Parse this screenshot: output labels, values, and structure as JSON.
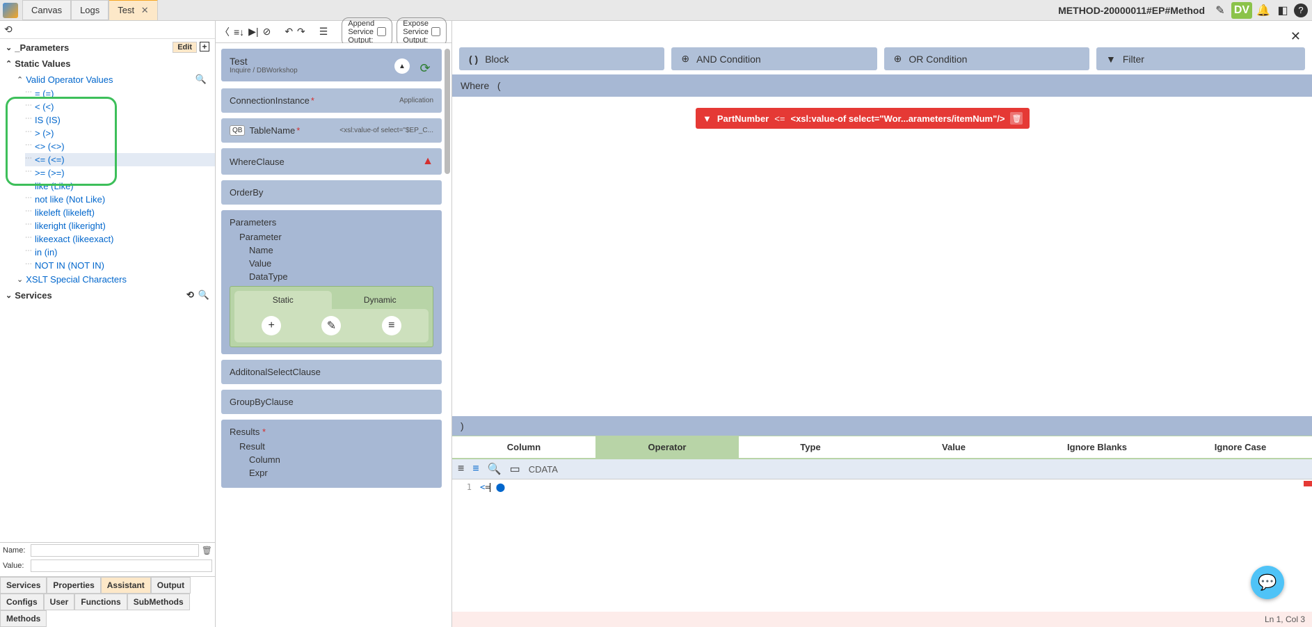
{
  "top": {
    "tabs": [
      "Canvas",
      "Logs",
      "Test"
    ],
    "active_tab": 2,
    "method_name": "METHOD-20000011#EP#Method",
    "dv": "DV"
  },
  "sidebar": {
    "parameters_label": "_Parameters",
    "edit_label": "Edit",
    "static_values_label": "Static Values",
    "valid_operators_label": "Valid Operator Values",
    "operators": [
      "= (=)",
      "< (<)",
      "IS (IS)",
      "> (>)",
      "<> (<>)",
      "<= (<=)",
      ">= (>=)",
      "like (Like)",
      "not like (Not Like)",
      "likeleft (likeleft)",
      "likeright (likeright)",
      "likeexact (likeexact)",
      "in (in)",
      "NOT IN (NOT IN)"
    ],
    "selected_operator_index": 5,
    "xslt_label": "XSLT Special Characters",
    "services_label": "Services",
    "name_label": "Name:",
    "value_label": "Value:",
    "bottom_tabs_row1": [
      "Services",
      "Properties",
      "Assistant",
      "Output"
    ],
    "bottom_tabs_row2": [
      "Configs",
      "User",
      "Functions",
      "SubMethods"
    ],
    "bottom_tabs_row3": [
      "Methods"
    ],
    "active_bottom_tab": "Assistant"
  },
  "middle": {
    "pill1": "Append Service Output:",
    "pill2": "Expose Service Output:",
    "warn_count": "1",
    "test_title": "Test",
    "test_sub": "Inquire / DBWorkshop",
    "cards": {
      "conn": {
        "label": "ConnectionInstance",
        "right": "Application"
      },
      "table": {
        "label": "TableName",
        "qb": "QB",
        "right": "<xsl:value-of select=\"$EP_C..."
      },
      "where": {
        "label": "WhereClause"
      },
      "orderby": {
        "label": "OrderBy"
      },
      "params": {
        "label": "Parameters",
        "parameter": "Parameter",
        "name": "Name",
        "value": "Value",
        "datatype": "DataType"
      },
      "static_tab": "Static",
      "dynamic_tab": "Dynamic",
      "addsel": {
        "label": "AdditonalSelectClause"
      },
      "groupby": {
        "label": "GroupByClause"
      },
      "results": {
        "label": "Results",
        "result": "Result",
        "column": "Column",
        "expr": "Expr"
      }
    }
  },
  "right": {
    "cond_buttons": [
      {
        "icon": "()",
        "label": "Block"
      },
      {
        "icon": "and",
        "label": "AND Condition"
      },
      {
        "icon": "or",
        "label": "OR Condition"
      },
      {
        "icon": "filter",
        "label": "Filter"
      }
    ],
    "where_label": "Where",
    "red_clause": {
      "field": "PartNumber",
      "op": "<=",
      "expr": "<xsl:value-of select=\"Wor...arameters/itemNum\"/>"
    },
    "close_paren": ")",
    "editor_tabs": [
      "Column",
      "Operator",
      "Type",
      "Value",
      "Ignore Blanks",
      "Ignore Case"
    ],
    "active_editor_tab": 1,
    "cdata_label": "CDATA",
    "code_line": "<=",
    "status": "Ln 1, Col 3"
  }
}
